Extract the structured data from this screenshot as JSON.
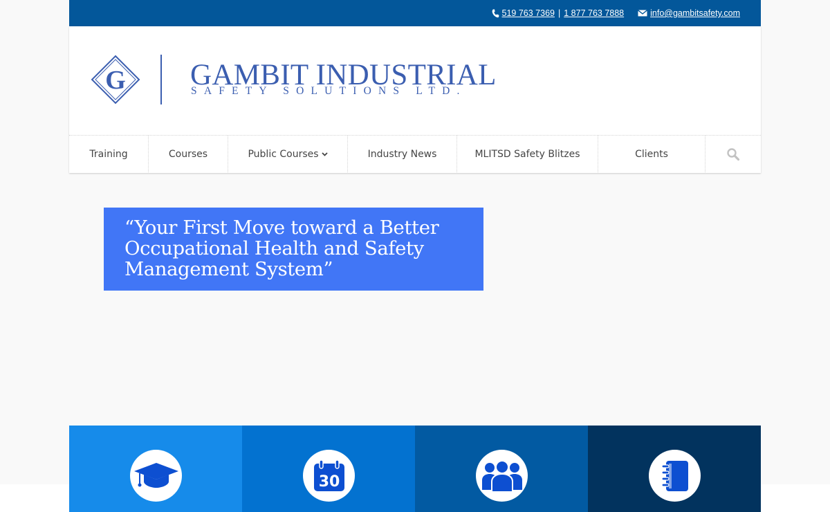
{
  "topbar": {
    "phone1": "519 763 7369",
    "divider": "|",
    "phone2": "1 877 763 7888",
    "email": "info@gambitsafety.com"
  },
  "logo": {
    "letter": "G",
    "name": "GAMBIT INDUSTRIAL",
    "tagline": "SAFETY SOLUTIONS LTD."
  },
  "nav": {
    "items": [
      {
        "label": "Training"
      },
      {
        "label": "Courses"
      },
      {
        "label": "Public Courses"
      },
      {
        "label": "Industry News"
      },
      {
        "label": "MLITSD Safety Blitzes"
      },
      {
        "label": "Clients"
      }
    ]
  },
  "hero": {
    "quote": "“Your First Move toward a Better Occupational Health and Safety Management System”"
  },
  "calendar": {
    "day": "30"
  },
  "colors": {
    "topbar": "#03579a",
    "brand": "#3b5eb0",
    "hero": "#4176f6",
    "tile1": "#168bea",
    "tile2": "#0372d0",
    "tile3": "#025aa2",
    "tile4": "#02335e"
  },
  "tiles": [
    {
      "icon": "graduation-cap-icon"
    },
    {
      "icon": "calendar-icon"
    },
    {
      "icon": "group-icon"
    },
    {
      "icon": "notebook-icon"
    }
  ]
}
